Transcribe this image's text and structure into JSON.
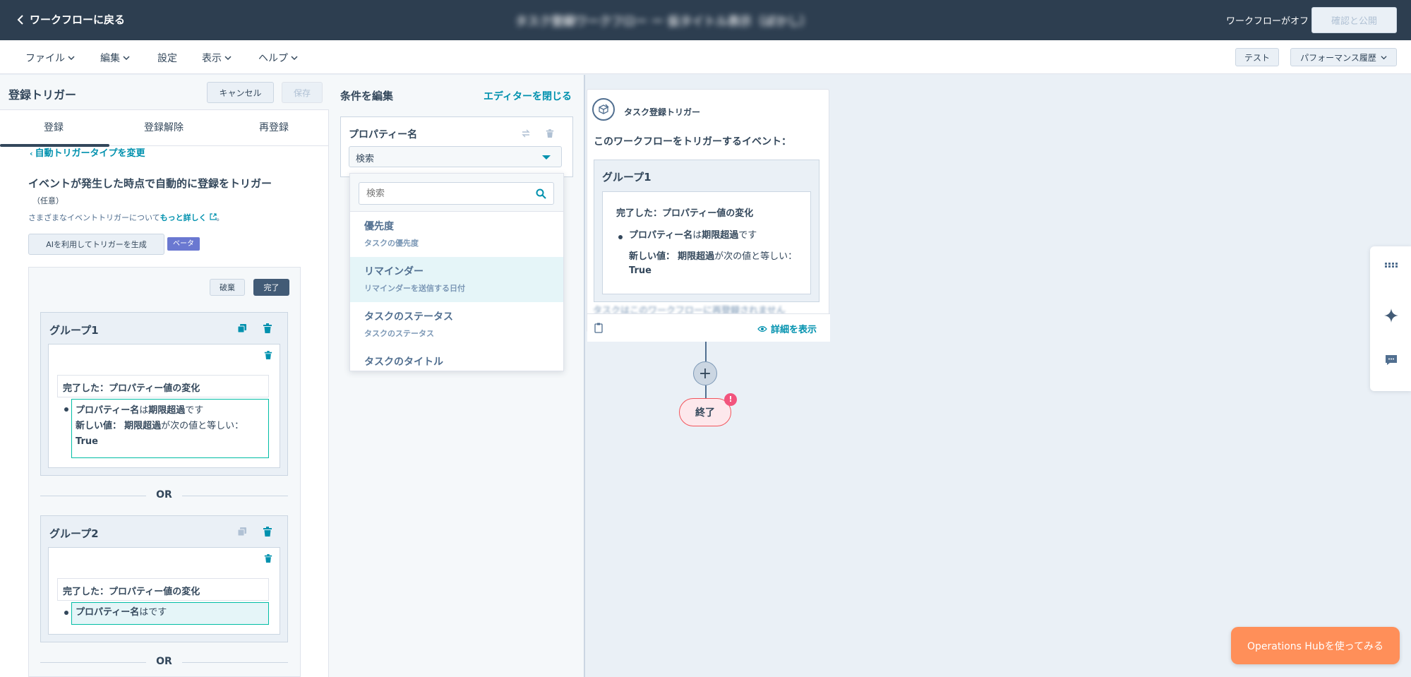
{
  "topbar": {
    "back_label": "ワークフローに戻る",
    "workflow_title": "タスク登録ワークフロー ー 仮タイトル表示（ぼかし）",
    "status": "ワークフローがオフ",
    "publish_label": "確認と公開"
  },
  "menubar": {
    "items": [
      "ファイル",
      "編集",
      "設定",
      "表示",
      "ヘルプ"
    ],
    "test_label": "テスト",
    "performance_label": "パフォーマンス履歴"
  },
  "left_panel": {
    "title": "登録トリガー",
    "cancel_label": "キャンセル",
    "save_label": "保存",
    "tabs": [
      "登録",
      "登録解除",
      "再登録"
    ],
    "change_type": "自動トリガータイプを変更",
    "event_title": "イベントが発生した時点で自動的に登録をトリガー",
    "optional": "（任意）",
    "learn_prefix": "さまざまなイベントトリガーについて",
    "learn_link": "もっと詳しく",
    "learn_suffix": "。",
    "ai_button": "AIを利用してトリガーを生成",
    "beta": "ベータ",
    "discard_label": "破棄",
    "done_label": "完了",
    "or_label": "OR",
    "groups": [
      {
        "title": "グループ1",
        "condition_title": "完了した：プロパティー値の変化",
        "property_name": "プロパティー名",
        "is_word": "は",
        "value": "期限超過",
        "desu": "です",
        "new_value_label": "新しい値：",
        "new_value": "期限超過",
        "equals_text": "が次の値と等しい：",
        "bool_value": "True"
      },
      {
        "title": "グループ2",
        "condition_title": "完了した：プロパティー値の変化",
        "property_name": "プロパティー名",
        "rest": "はです"
      }
    ]
  },
  "mid_panel": {
    "title": "条件を編集",
    "close_label": "エディターを閉じる",
    "property_label": "プロパティー名",
    "select_value": "検索",
    "search_placeholder": "検索",
    "options": [
      {
        "title": "優先度",
        "subtitle": "タスクの優先度"
      },
      {
        "title": "リマインダー",
        "subtitle": "リマインダーを送信する日付"
      },
      {
        "title": "タスクのステータス",
        "subtitle": "タスクのステータス"
      },
      {
        "title": "タスクのタイトル",
        "subtitle": ""
      }
    ]
  },
  "canvas": {
    "trigger_label": "タスク登録トリガー",
    "trigger_sub": "このワークフローをトリガーするイベント：",
    "group_title": "グループ1",
    "cond_title": "完了した：プロパティー値の変化",
    "property_name": "プロパティー名",
    "is_word": "は",
    "value": "期限超過",
    "desu": "です",
    "new_value_label": "新しい値：",
    "new_value": "期限超過",
    "equals_text": "が次の値と等しい：",
    "bool_value": "True",
    "ghost_text": "タスクはこのワークフローに再登録されません",
    "details_label": "詳細を表示",
    "end_label": "終了",
    "end_badge": "!"
  },
  "promo": {
    "label": "Operations Hubを使ってみる"
  },
  "colors": {
    "topbar": "#2d3e50",
    "link": "#0091ae",
    "accent_teal": "#00bda5",
    "promo": "#ff8f59",
    "beta": "#6a78d1"
  }
}
